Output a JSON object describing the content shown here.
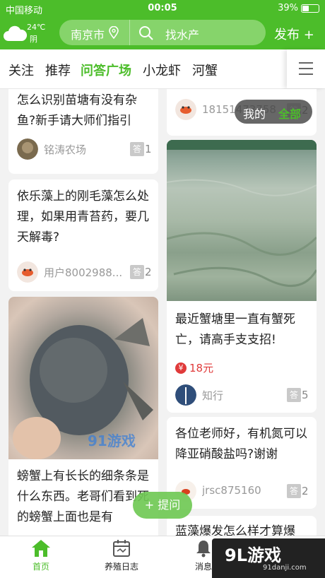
{
  "status": {
    "carrier": "中国移动",
    "time": "00:05",
    "battery_text": "39%",
    "battery_level": 0.39
  },
  "header": {
    "temp": "24℃",
    "condition": "阴",
    "city": "南京市",
    "search_placeholder": "找水产",
    "publish": "发布 +"
  },
  "tabs": [
    "关注",
    "推荐",
    "问答广场",
    "小龙虾",
    "河蟹"
  ],
  "active_tab": "问答广场",
  "toggle": {
    "mine": "我的",
    "all": "全部"
  },
  "cards": [
    {
      "title": "怎么识别苗塘有没有杂鱼?新手请大师们指引",
      "author": "铭涛农场",
      "answers": "1"
    },
    {
      "title": "依乐藻上的刚毛藻怎么处理，如果用青苔药，要几天解毒?",
      "author": "用户8002988...",
      "answers": "2"
    },
    {
      "title": "螃蟹上有长长的细条条是什么东西。老哥们看到死的螃蟹上面也是有",
      "author": ""
    },
    {
      "title": "",
      "author": "18151473758",
      "answers": "2"
    },
    {
      "title": "最近蟹塘里一直有蟹死亡，请高手支支招!",
      "bounty": "18元",
      "author": "知行",
      "answers": "5"
    },
    {
      "title": "各位老师好，有机氮可以降亚硝酸盐吗?谢谢",
      "author": "jrsc875160",
      "answers": "2"
    },
    {
      "title": "蓝藻爆发怎么样才算爆"
    }
  ],
  "answer_badge": "答",
  "ask_button": "+ 提问",
  "photo_watermark": "91游戏",
  "bottom_nav": [
    "首页",
    "养殖日志",
    "消息"
  ],
  "watermark": {
    "logo": "9L游戏",
    "url": "91danji.com"
  },
  "colors": {
    "accent": "#4cbd2a",
    "bounty": "#e03a3a"
  }
}
